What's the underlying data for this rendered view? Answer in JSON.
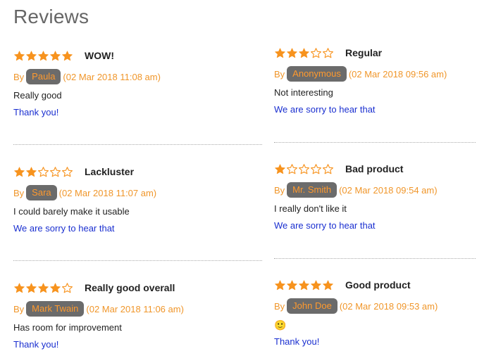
{
  "page": {
    "title": "Reviews"
  },
  "colors": {
    "star": "#f7931e",
    "star_outline": "#f7931e",
    "meta": "#f0962a",
    "author_bg": "#6b6b6b",
    "reply": "#1a2fd0"
  },
  "left_reviews": [
    {
      "rating": 5,
      "title": "WOW!",
      "by": "By",
      "author": "Paula",
      "date": "(02 Mar 2018 11:08 am)",
      "text": "Really good",
      "reply": "Thank you!"
    },
    {
      "rating": 2,
      "title": "Lackluster",
      "by": "By",
      "author": "Sara",
      "date": "(02 Mar 2018 11:07 am)",
      "text": "I could barely make it usable",
      "reply": "We are sorry to hear that"
    },
    {
      "rating": 4,
      "title": "Really good overall",
      "by": "By",
      "author": "Mark Twain",
      "date": "(02 Mar 2018 11:06 am)",
      "text": "Has room for improvement",
      "reply": "Thank you!"
    }
  ],
  "right_reviews": [
    {
      "rating": 3,
      "title": "Regular",
      "by": "By",
      "author": "Anonymous",
      "date": "(02 Mar 2018 09:56 am)",
      "text": "Not interesting",
      "reply": "We are sorry to hear that"
    },
    {
      "rating": 1,
      "title": "Bad product",
      "by": "By",
      "author": "Mr. Smith",
      "date": "(02 Mar 2018 09:54 am)",
      "text": "I really don't like it",
      "reply": "We are sorry to hear that"
    },
    {
      "rating": 5,
      "title": "Good product",
      "by": "By",
      "author": "John Doe",
      "date": "(02 Mar 2018 09:53 am)",
      "text": "🙂",
      "reply": "Thank you!"
    }
  ]
}
